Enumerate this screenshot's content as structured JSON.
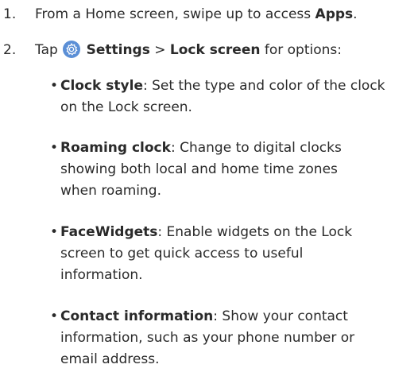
{
  "steps": [
    {
      "number": "1.",
      "pre": "From a Home screen, swipe up to access ",
      "bold": "Apps",
      "post": "."
    },
    {
      "number": "2.",
      "pre": "Tap ",
      "icon": "settings-gear-icon",
      "bold1": "Settings",
      "sep": " > ",
      "bold2": "Lock screen",
      "post": " for options:"
    }
  ],
  "options": [
    {
      "term": "Clock style",
      "desc_lines": [
        ": Set the type and color of the clock",
        "on the Lock screen."
      ]
    },
    {
      "term": "Roaming clock",
      "desc_lines": [
        ": Change to digital clocks",
        "showing both local and home time zones",
        "when roaming."
      ]
    },
    {
      "term": "FaceWidgets",
      "desc_lines": [
        ": Enable widgets on the Lock",
        "screen to get quick access to useful",
        "information."
      ]
    },
    {
      "term": "Contact information",
      "desc_lines": [
        ": Show your contact",
        "information, such as your phone number or",
        "email address."
      ]
    }
  ],
  "colors": {
    "text": "#2a2a2a",
    "icon_bg": "#5b8fd6"
  }
}
